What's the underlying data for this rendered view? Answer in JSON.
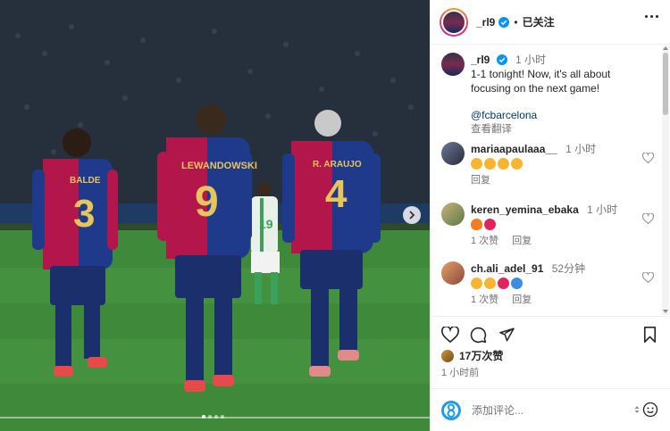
{
  "header": {
    "username": "_rl9",
    "follow_state": "已关注",
    "separator": "•"
  },
  "caption": {
    "username": "_rl9",
    "time": "1 小时",
    "text": "1-1 tonight! Now, it's all about\nfocusing on the next game!",
    "mention": "@fcbarcelona",
    "translate": "查看翻译"
  },
  "comments": [
    {
      "username": "mariaapaulaaa__",
      "time": "1 小时",
      "emojis": [
        "heart-eyes",
        "heart-eyes",
        "heart-eyes",
        "heart-eyes"
      ],
      "reply": "回复",
      "likes": ""
    },
    {
      "username": "keren_yemina_ebaka",
      "time": "1 小时",
      "emojis": [
        "fire",
        "red-heart"
      ],
      "likes": "1 次赞",
      "reply": "回复"
    },
    {
      "username": "ch.ali_adel_91",
      "time": "52分钟",
      "emojis": [
        "raised-hands",
        "clap",
        "red-heart",
        "blue-heart"
      ],
      "likes": "1 次赞",
      "reply": "回复"
    }
  ],
  "post": {
    "likes": "17万次赞",
    "time": "1 小时前"
  },
  "comment_box": {
    "placeholder": "添加评论..."
  },
  "photo": {
    "players": [
      {
        "name": "BALDE",
        "number": "3"
      },
      {
        "name": "LEWANDOWSKI",
        "number": "9"
      },
      {
        "name": "R. ARAUJO",
        "number": "4"
      },
      {
        "number": "19"
      }
    ],
    "slide_count": 4,
    "active_slide": 1
  },
  "colors": {
    "blaugrana_blue": "#1f3a8a",
    "blaugrana_red": "#b3164a",
    "gold_number": "#e6c55a",
    "link": "#00376b",
    "muted": "#737373"
  }
}
